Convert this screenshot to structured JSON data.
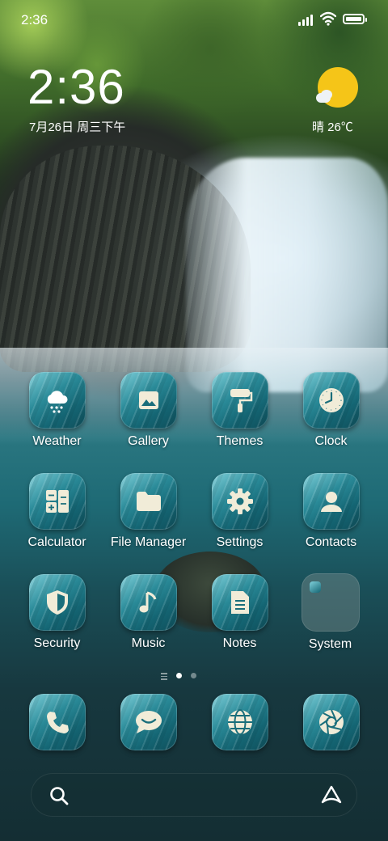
{
  "status_bar": {
    "time": "2:36"
  },
  "clock_widget": {
    "time": "2:36",
    "date": "7月26日 周三下午"
  },
  "weather_widget": {
    "text": "晴 26℃",
    "icon": "sun-cloud-icon",
    "sun_color": "#f5c518"
  },
  "apps": [
    {
      "label": "Weather",
      "icon": "weather-icon"
    },
    {
      "label": "Gallery",
      "icon": "gallery-icon"
    },
    {
      "label": "Themes",
      "icon": "themes-icon"
    },
    {
      "label": "Clock",
      "icon": "clock-icon"
    },
    {
      "label": "Calculator",
      "icon": "calculator-icon"
    },
    {
      "label": "File Manager",
      "icon": "folder-icon"
    },
    {
      "label": "Settings",
      "icon": "gear-icon"
    },
    {
      "label": "Contacts",
      "icon": "contacts-icon"
    },
    {
      "label": "Security",
      "icon": "shield-icon"
    },
    {
      "label": "Music",
      "icon": "music-note-icon"
    },
    {
      "label": "Notes",
      "icon": "notes-icon"
    },
    {
      "label": "System",
      "icon": "folder-icon"
    }
  ],
  "page_indicator": {
    "pages": 2,
    "current": 1
  },
  "dock": [
    {
      "icon": "phone-icon"
    },
    {
      "icon": "messages-icon"
    },
    {
      "icon": "browser-icon"
    },
    {
      "icon": "camera-icon"
    }
  ],
  "search_bar": {
    "left_icon": "search-icon",
    "right_icon": "assistant-icon"
  },
  "colors": {
    "icon_tile": "#2a8a98",
    "text": "#ffffff"
  }
}
